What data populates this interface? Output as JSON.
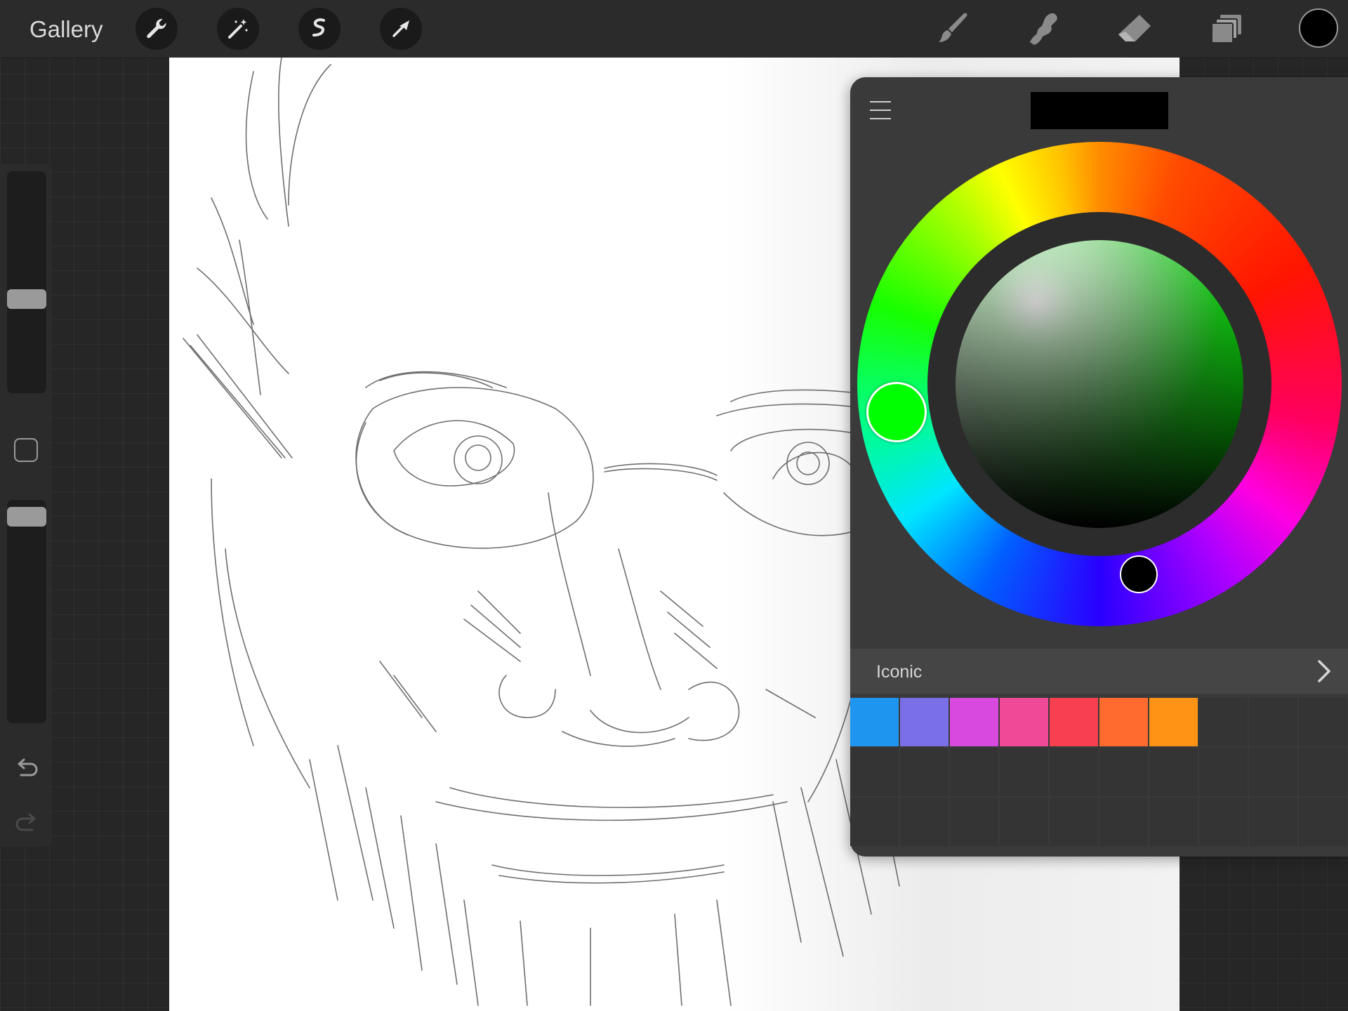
{
  "toolbar": {
    "gallery_label": "Gallery",
    "left_tools": [
      "wrench-icon",
      "magic-wand-icon",
      "selection-icon",
      "transform-arrow-icon"
    ],
    "right_tools": [
      "brush-icon",
      "smudge-icon",
      "eraser-icon",
      "layers-icon"
    ],
    "current_color": "#000000"
  },
  "sidebar": {
    "brush_size_level": 0.57,
    "opacity_level": 0.95,
    "icons": [
      "modify-square-icon",
      "undo-icon",
      "redo-icon"
    ]
  },
  "color_panel": {
    "menu_icon": "hamburger-menu-icon",
    "current_swatch": "#000000",
    "selected_hue": "#00ff00",
    "selected_color": "#000000",
    "palette": {
      "name": "Iconic",
      "colors": [
        "#1e96f0",
        "#7b6fe8",
        "#d84adf",
        "#ee4a97",
        "#f73f4f",
        "#ff6b2f",
        "#ff9316"
      ]
    }
  }
}
